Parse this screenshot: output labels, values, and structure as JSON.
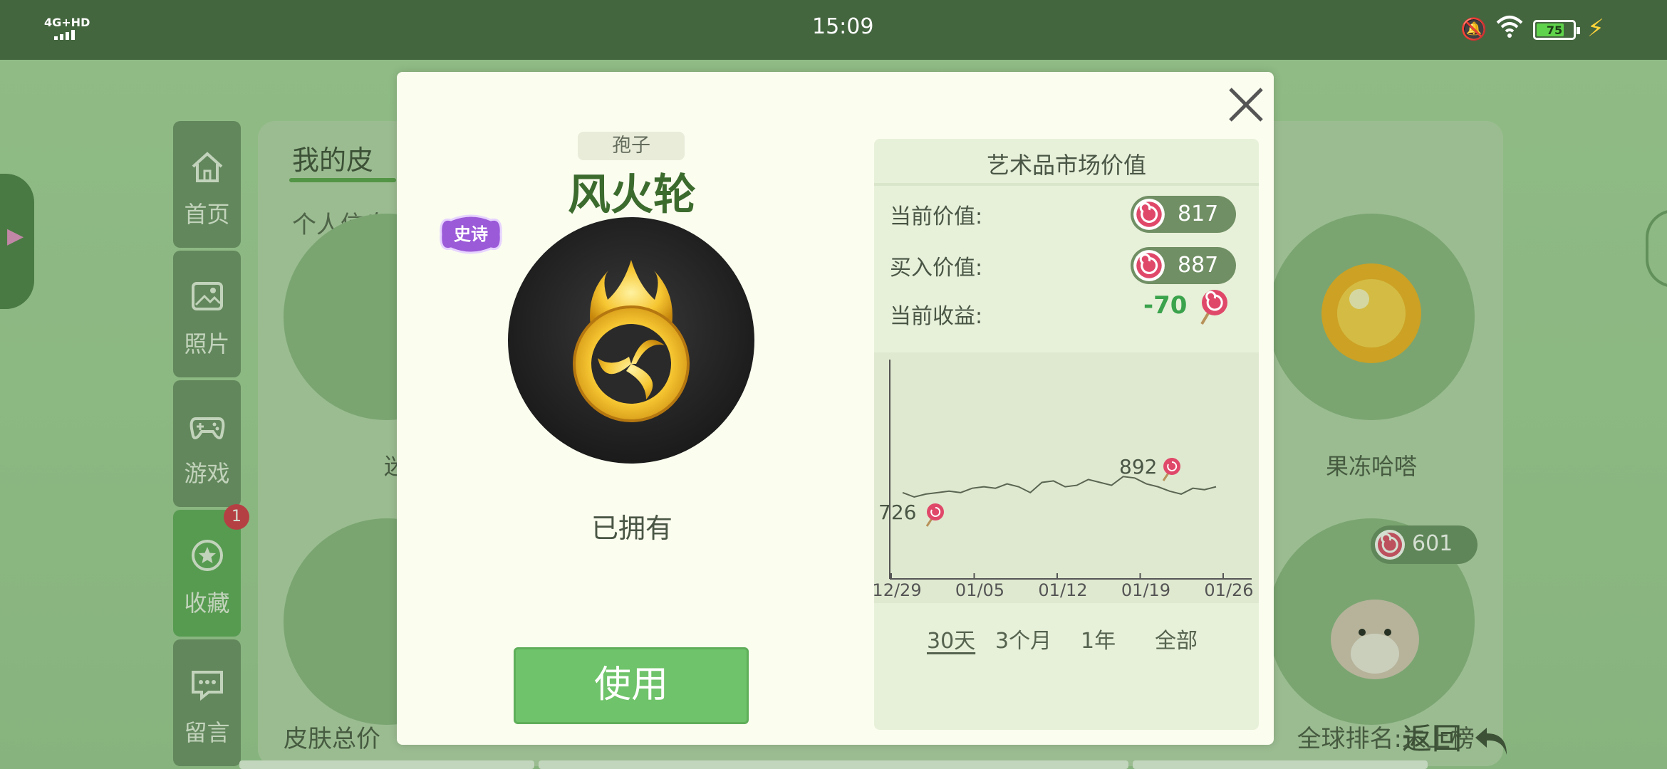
{
  "status_bar": {
    "network": "4G+HD",
    "time": "15:09",
    "battery": "75"
  },
  "sidebar": {
    "items": [
      {
        "label": "首页",
        "icon": "home-icon"
      },
      {
        "label": "照片",
        "icon": "photo-icon"
      },
      {
        "label": "游戏",
        "icon": "gamepad-icon"
      },
      {
        "label": "收藏",
        "icon": "star-icon",
        "badge": "1"
      },
      {
        "label": "留言",
        "icon": "message-icon"
      }
    ]
  },
  "background": {
    "tab_title": "我的皮",
    "subtitle": "个人信息",
    "items": [
      {
        "name": "迷你"
      },
      {
        "name": "果冻哈嗒"
      }
    ],
    "price_tag": "601",
    "bottom_left": "皮肤总价",
    "bottom_right": "全球排名:未上榜",
    "back": "返回"
  },
  "modal": {
    "rank_tag": "孢子",
    "title": "风火轮",
    "rarity": "史诗",
    "status": "已拥有",
    "use_button": "使用",
    "market": {
      "heading": "艺术品市场价值",
      "current_value_label": "当前价值:",
      "current_value": "817",
      "buy_value_label": "买入价值:",
      "buy_value": "887",
      "profit_label": "当前收益:",
      "profit": "-70",
      "ranges": [
        "30天",
        "3个月",
        "1年",
        "全部"
      ],
      "active_range": "30天"
    }
  },
  "chart_data": {
    "type": "line",
    "x_ticks": [
      "12/29",
      "01/05",
      "01/12",
      "01/19",
      "01/26"
    ],
    "series": [
      {
        "values": [
          818,
          812,
          816,
          818,
          820,
          818,
          824,
          826,
          824,
          830,
          826,
          818,
          832,
          834,
          826,
          828,
          836,
          832,
          828,
          840,
          838,
          830,
          826,
          820,
          816,
          824,
          822,
          826
        ]
      }
    ],
    "min_label": "726",
    "max_label": "892",
    "ylim": [
      700,
      1000
    ],
    "colors": {
      "line": "#5a6552",
      "axis": "#555555",
      "candy": "#e0486a"
    }
  }
}
